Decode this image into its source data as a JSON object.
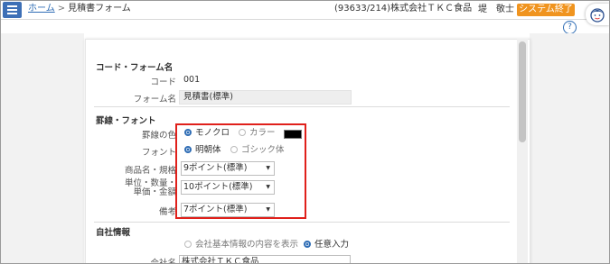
{
  "header": {
    "breadcrumb_home": "ホーム",
    "breadcrumb_sep": ">",
    "breadcrumb_current": "見積書フォーム",
    "company": "(93633/214)株式会社ＴＫＣ食品",
    "user": "堤　敬士",
    "user_caret": "▼",
    "exit_button": "システム終了",
    "help_icon": "?"
  },
  "form": {
    "section_code": "コード・フォーム名",
    "code_label": "コード",
    "code_value": "001",
    "formname_label": "フォーム名",
    "formname_value": "見積書(標準)",
    "section_font": "罫線・フォント",
    "line_color_label": "罫線の色",
    "line_color_mono": "モノクロ",
    "line_color_color": "カラー",
    "font_label": "フォント",
    "font_mincho": "明朝体",
    "font_gothic": "ゴシック体",
    "product_label": "商品名・規格",
    "product_value": "9ポイント(標準)",
    "unit_label_1": "単位・数量・",
    "unit_label_2": "単価・金額",
    "unit_value": "10ポイント(標準)",
    "remarks_label": "備考",
    "remarks_value": "7ポイント(標準)",
    "section_company": "自社情報",
    "company_opt_basic": "会社基本情報の内容を表示",
    "company_opt_manual": "任意入力",
    "company_name_label": "会社名",
    "company_name_value": "株式会社ＴＫＣ食品"
  },
  "colors": {
    "accent": "#2f6db5",
    "exit_button": "#f0941f",
    "highlight": "#e0201b",
    "swatch": "#000000"
  },
  "icons": {
    "menu": "hamburger-icon",
    "help": "help-icon",
    "avatar": "user-avatar-icon",
    "dropdown": "chevron-down-icon"
  }
}
